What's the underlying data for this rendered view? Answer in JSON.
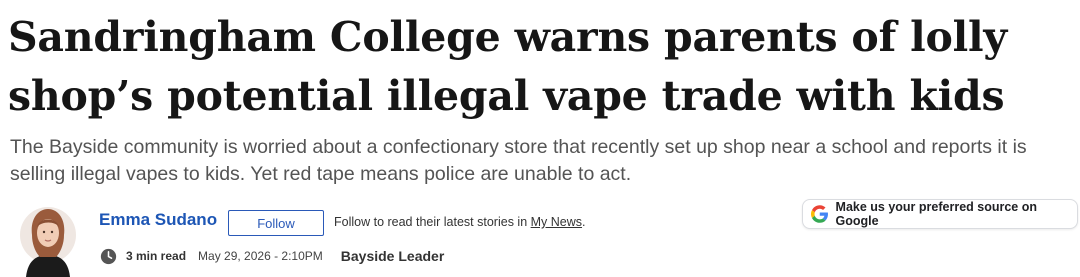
{
  "article": {
    "headline": "Sandringham College warns parents of lolly shop’s potential illegal vape trade with kids",
    "standfirst": "The Bayside community is worried about a confectionary store that recently set up shop near a school and reports it is selling illegal vapes to kids. Yet red tape means police are unable to act."
  },
  "author": {
    "name": "Emma Sudano",
    "follow_label": "Follow",
    "follow_note_prefix": "Follow to read their latest stories in ",
    "follow_note_link": "My News",
    "follow_note_suffix": "."
  },
  "google_source": {
    "label": "Make us your preferred source on Google",
    "icon": "google-g-icon"
  },
  "meta": {
    "clock_icon": "clock-icon",
    "read_time": "3 min read",
    "date": "May 29, 2026 - 2:10PM",
    "masthead": "Bayside Leader"
  },
  "colors": {
    "author_link": "#1d56b5",
    "follow_border": "#2a59b8",
    "headline": "#161616",
    "standfirst": "#545454"
  }
}
